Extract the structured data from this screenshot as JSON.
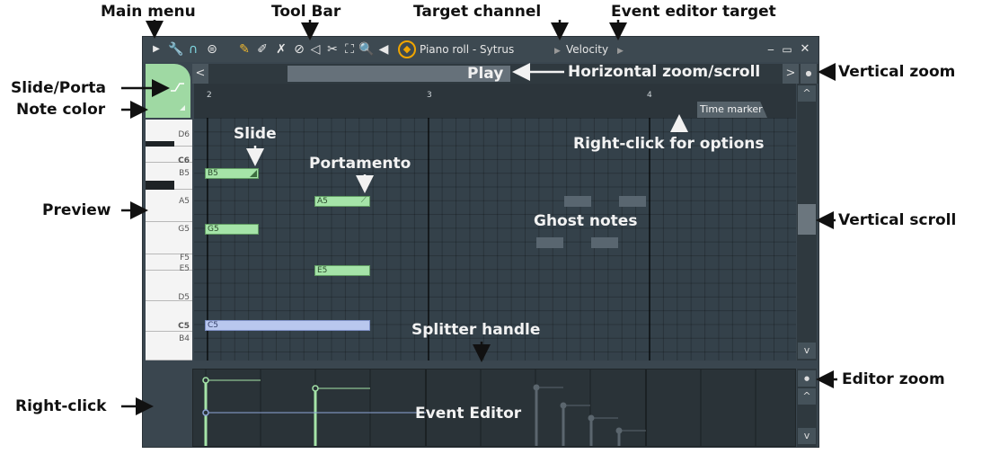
{
  "annotations": {
    "main_menu": "Main menu",
    "tool_bar": "Tool Bar",
    "target_channel": "Target channel",
    "event_editor_target": "Event editor target",
    "slide_porta": "Slide/Porta",
    "note_color": "Note color",
    "preview": "Preview",
    "right_click": "Right-click",
    "horizontal_zoom_scroll": "Horizontal zoom/scroll",
    "vertical_zoom": "Vertical zoom",
    "vertical_scroll": "Vertical scroll",
    "editor_zoom": "Editor zoom",
    "slide": "Slide",
    "portamento": "Portamento",
    "ghost_notes": "Ghost notes",
    "right_click_for_options": "Right-click for options",
    "splitter_handle": "Splitter handle",
    "event_editor": "Event Editor"
  },
  "titlebar": {
    "title": "Piano roll - Sytrus",
    "target": "Velocity",
    "minimize_icon": "minimize-icon",
    "maximize_icon": "maximize-icon",
    "close_icon": "close-icon"
  },
  "scroll": {
    "play_label": "Play",
    "left_arrow": "<",
    "right_arrow": ">",
    "up_arrow": "^",
    "down_arrow": "v"
  },
  "timeline": {
    "bars": [
      "2",
      "3",
      "4"
    ],
    "time_marker": "Time marker"
  },
  "keyboard": {
    "labels": [
      "D6",
      "C6",
      "B5",
      "A5",
      "G5",
      "F5",
      "E5",
      "D5",
      "C5",
      "B4"
    ]
  },
  "notes": [
    {
      "label": "B5",
      "pitch": "B5"
    },
    {
      "label": "A5",
      "pitch": "A5"
    },
    {
      "label": "G5",
      "pitch": "G5"
    },
    {
      "label": "E5",
      "pitch": "E5"
    },
    {
      "label": "C5",
      "pitch": "C5"
    }
  ],
  "colors": {
    "note_green": "#a5e4a8",
    "note_blue": "#b9c7ee",
    "accent_orange": "#f0a500",
    "window_bg": "#3a464f"
  }
}
